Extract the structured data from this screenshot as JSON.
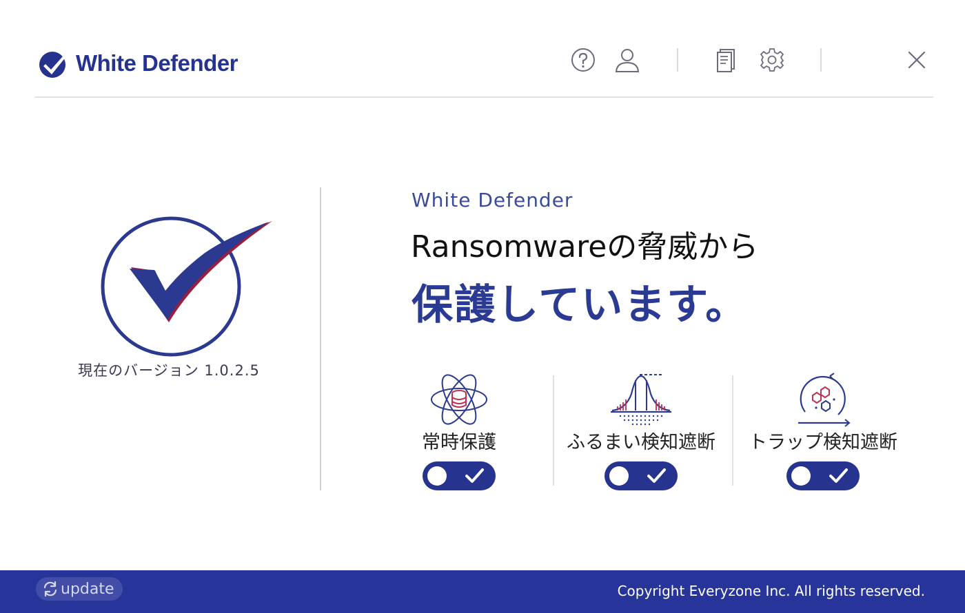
{
  "brand": {
    "name": "White Defender",
    "accent": "#25338f"
  },
  "toolbar": {
    "help_icon": "help-circle-icon",
    "account_icon": "user-icon",
    "report_icon": "document-icon",
    "settings_icon": "gear-icon",
    "close_icon": "close-icon"
  },
  "status": {
    "version_text": "現在のバージョン 1.0.2.5",
    "subtitle": "White Defender",
    "headline_line1": "Ransomwareの脅威から",
    "headline_line2": "保護しています。"
  },
  "features": [
    {
      "label": "常時保護",
      "icon": "atom-database-icon",
      "enabled": true
    },
    {
      "label": "ふるまい検知遮断",
      "icon": "bell-curve-icon",
      "enabled": true
    },
    {
      "label": "トラップ検知遮断",
      "icon": "hexagon-cycle-icon",
      "enabled": true
    }
  ],
  "footer": {
    "update_label": "update",
    "copyright": "Copyright Everyzone Inc. All rights reserved.",
    "background": "#27359a"
  }
}
